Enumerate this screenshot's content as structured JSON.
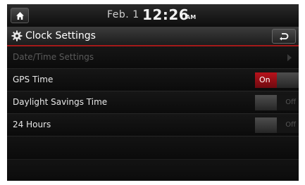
{
  "status": {
    "date": "Feb.  1",
    "time": "12:26",
    "ampm": "AM"
  },
  "header": {
    "title": "Clock Settings"
  },
  "settings": [
    {
      "label": "Date/Time Settings",
      "enabled": false,
      "control": "chevron"
    },
    {
      "label": "GPS Time",
      "enabled": true,
      "control": "toggle",
      "state_label": "On",
      "on": true
    },
    {
      "label": "Daylight Savings Time",
      "enabled": true,
      "control": "toggle",
      "state_label": "Off",
      "on": false
    },
    {
      "label": "24 Hours",
      "enabled": true,
      "control": "toggle",
      "state_label": "Off",
      "on": false
    }
  ],
  "colors": {
    "accent": "#a31a1a",
    "toggle_on": "#b8121b",
    "background": "#0b0b0b"
  },
  "icons": {
    "home": "home-icon",
    "settings": "gear-icon",
    "back": "back-arrow-icon"
  }
}
